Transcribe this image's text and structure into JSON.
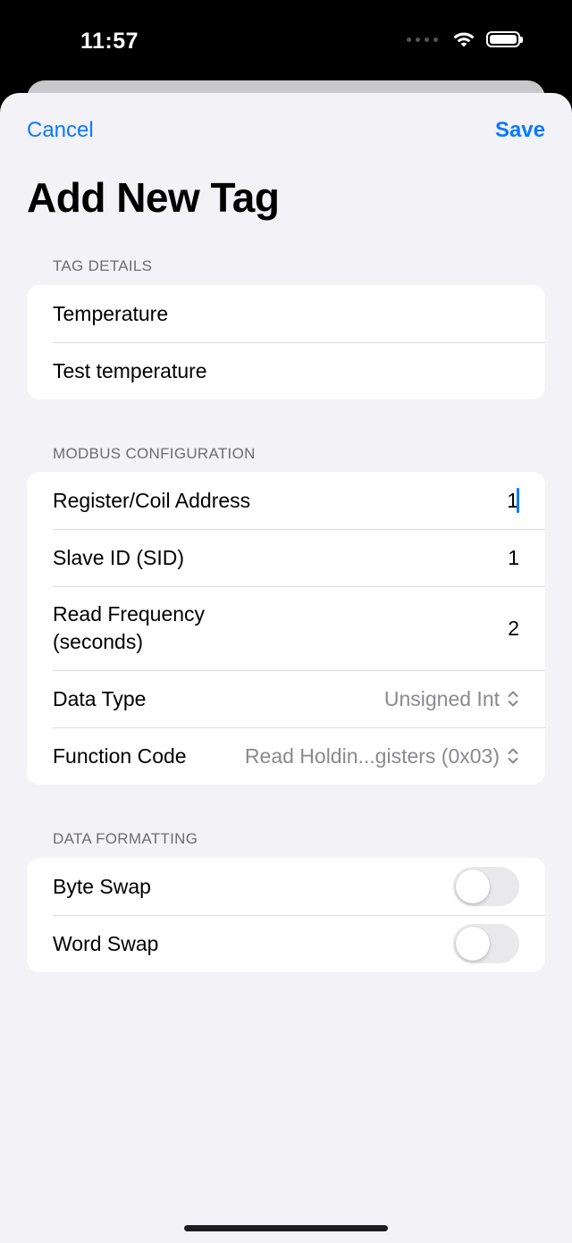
{
  "status_bar": {
    "time": "11:57",
    "wifi_icon": "wifi-icon",
    "battery_icon": "battery-icon"
  },
  "nav": {
    "cancel_label": "Cancel",
    "save_label": "Save",
    "title": "Add New Tag"
  },
  "tag_details": {
    "header": "TAG DETAILS",
    "name_value": "Temperature",
    "description_value": "Test temperature"
  },
  "modbus": {
    "header": "MODBUS CONFIGURATION",
    "address_label": "Register/Coil Address",
    "address_value": "1",
    "slave_label": "Slave ID (SID)",
    "slave_value": "1",
    "frequency_label": "Read Frequency (seconds)",
    "frequency_value": "2",
    "data_type_label": "Data Type",
    "data_type_value": "Unsigned Int",
    "function_code_label": "Function Code",
    "function_code_value": "Read Holdin...gisters (0x03)"
  },
  "formatting": {
    "header": "DATA FORMATTING",
    "byte_swap_label": "Byte Swap",
    "byte_swap_on": false,
    "word_swap_label": "Word Swap",
    "word_swap_on": false
  },
  "colors": {
    "accent": "#0a7aff",
    "background": "#f2f2f7",
    "secondary_text": "#8a8a8e"
  }
}
